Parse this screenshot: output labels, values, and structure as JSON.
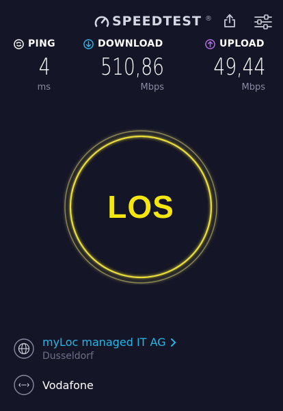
{
  "header": {
    "logo_text": "SPEEDTEST",
    "logo_mark": "®"
  },
  "metrics": {
    "ping": {
      "label": "PING",
      "value": "4",
      "unit": "ms"
    },
    "download": {
      "label": "DOWNLOAD",
      "value": "510,86",
      "unit": "Mbps"
    },
    "upload": {
      "label": "UPLOAD",
      "value": "49,44",
      "unit": "Mbps"
    }
  },
  "go_button": {
    "label": "LOS"
  },
  "server": {
    "name": "myLoc managed IT AG",
    "location": "Dusseldorf"
  },
  "carrier": {
    "name": "Vodafone"
  },
  "colors": {
    "background": "#141526",
    "accent_yellow": "#f5e70d",
    "download_cyan": "#25b6e8",
    "upload_purple": "#b46ee8",
    "muted": "#8a8ba3"
  },
  "icons": {
    "logo": "gauge-icon",
    "share": "share-icon",
    "settings": "sliders-icon",
    "ping": "ping-icon",
    "download": "download-arrow-icon",
    "upload": "upload-arrow-icon",
    "server": "globe-icon",
    "carrier": "connection-icon",
    "server_link": "chevron-right-icon"
  }
}
